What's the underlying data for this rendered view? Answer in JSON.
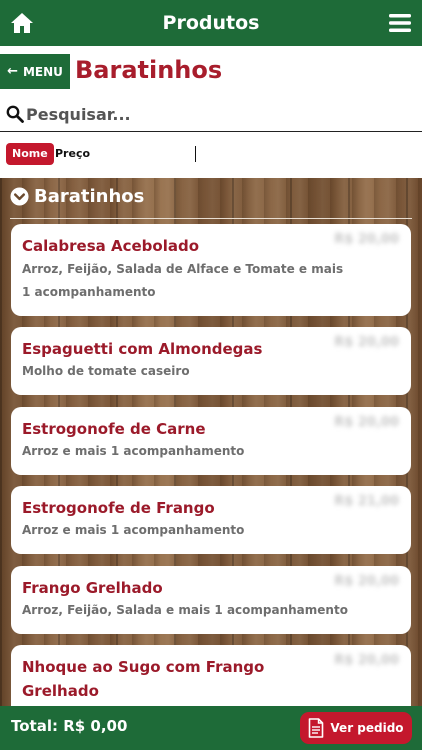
{
  "topbar": {
    "title": "Produtos",
    "home_icon": "home-icon",
    "menu_icon": "hamburger-icon"
  },
  "header": {
    "menu_label": "MENU",
    "back_icon": "arrow-left-icon",
    "page_title": "Baratinhos"
  },
  "search": {
    "placeholder": "Pesquisar...",
    "value": "",
    "icon": "search-icon"
  },
  "sort": {
    "options": [
      "Nome",
      "Preço"
    ],
    "selected": "Nome"
  },
  "section": {
    "title": "Baratinhos",
    "icon": "chevron-circle-down-icon"
  },
  "products": [
    {
      "name": "Calabresa Acebolado",
      "description": "Arroz, Feijão, Salada de Alface e Tomate e mais 1 acompanhamento",
      "price": "R$ 20,00"
    },
    {
      "name": "Espaguetti com Almondegas",
      "description": "Molho de tomate caseiro",
      "price": "R$ 20,00"
    },
    {
      "name": "Estrogonofe de Carne",
      "description": "Arroz e mais 1 acompanhamento",
      "price": "R$ 20,00"
    },
    {
      "name": "Estrogonofe de Frango",
      "description": "Arroz e mais 1 acompanhamento",
      "price": "R$ 21,00"
    },
    {
      "name": "Frango Grelhado",
      "description": "Arroz, Feijão, Salada e mais 1 acompanhamento",
      "price": "R$ 20,00"
    },
    {
      "name": "Nhoque ao Sugo com Frango Grelhado",
      "description": "",
      "price": "R$ 20,00"
    }
  ],
  "footer": {
    "total": "Total: R$ 0,00",
    "order_label": "Ver pedido",
    "order_icon": "document-icon"
  },
  "colors": {
    "brand_green": "#1e6b38",
    "accent_red": "#c4182d",
    "title_red": "#a81d2c"
  }
}
